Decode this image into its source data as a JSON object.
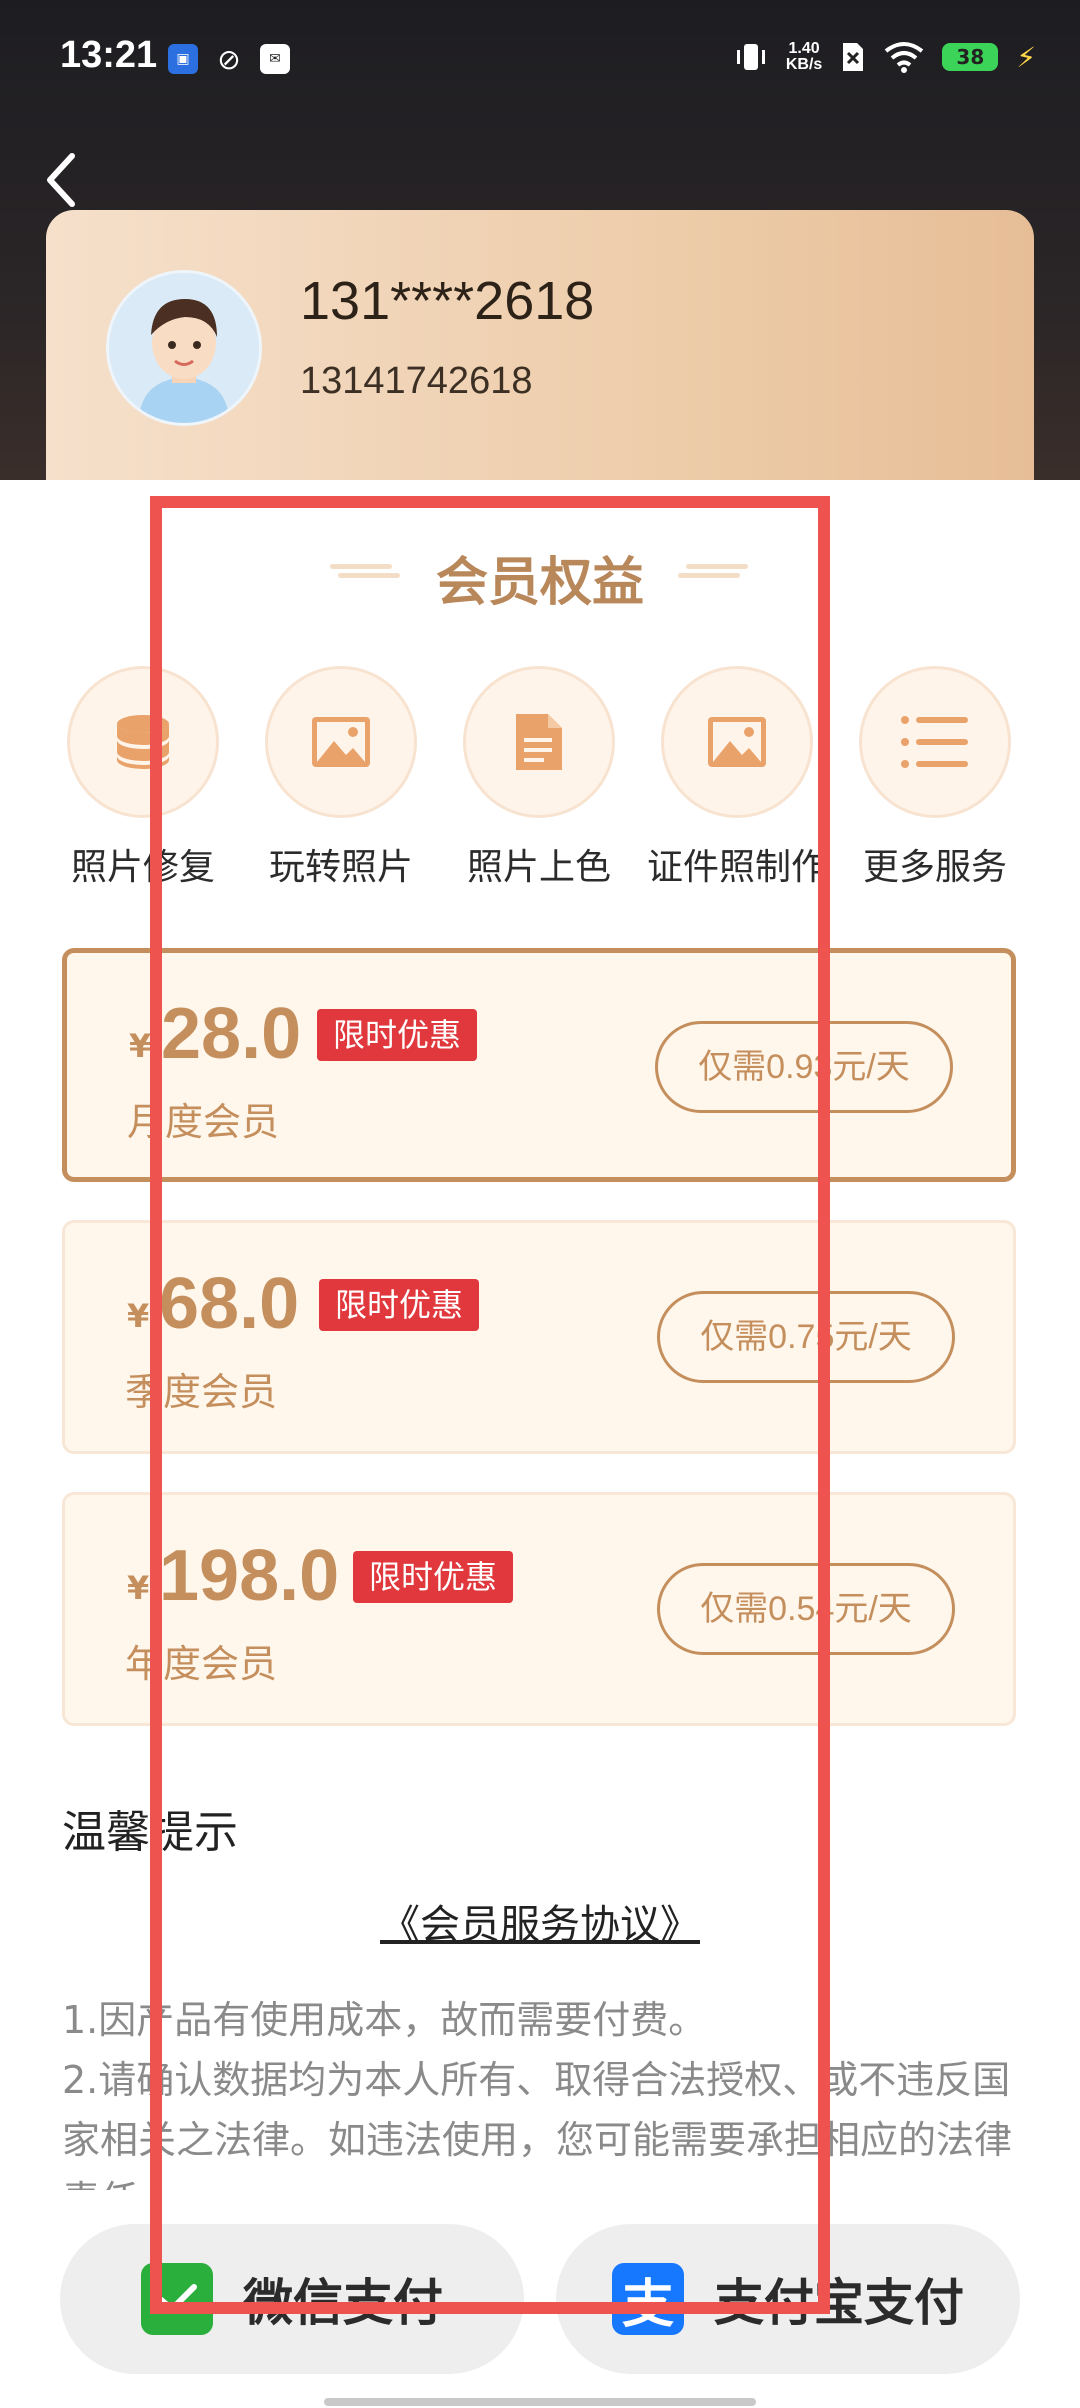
{
  "status_bar": {
    "time": "13:21",
    "speed_value": "1.40",
    "speed_unit": "KB/s",
    "battery": "38"
  },
  "profile": {
    "masked_name": "131****2618",
    "phone": "13141742618"
  },
  "benefits": {
    "title": "会员权益",
    "items": [
      {
        "label": "照片修复",
        "icon": "database-icon"
      },
      {
        "label": "玩转照片",
        "icon": "image-icon"
      },
      {
        "label": "照片上色",
        "icon": "document-icon"
      },
      {
        "label": "证件照制作",
        "icon": "image-icon"
      },
      {
        "label": "更多服务",
        "icon": "list-icon"
      }
    ]
  },
  "plans": [
    {
      "currency": "¥",
      "price": "28.0",
      "tag": "限时优惠",
      "name": "月度会员",
      "daily": "仅需0.93元/天",
      "selected": true
    },
    {
      "currency": "¥",
      "price": "68.0",
      "tag": "限时优惠",
      "name": "季度会员",
      "daily": "仅需0.75元/天",
      "selected": false
    },
    {
      "currency": "¥",
      "price": "198.0",
      "tag": "限时优惠",
      "name": "年度会员",
      "daily": "仅需0.54元/天",
      "selected": false
    }
  ],
  "tips": {
    "title": "温馨提示",
    "agreement": "《会员服务协议》",
    "line1": "1.因产品有使用成本，故而需要付费。",
    "line2": " 2.请确认数据均为本人所有、取得合法授权、或不违反国家相关之法律。如违法使用，您可能需要承担相应的法律责任。"
  },
  "payment": {
    "wechat_label": "微信支付",
    "alipay_label": "支付宝支付",
    "wechat_color": "#2aae3c",
    "alipay_color": "#1677ff"
  },
  "colors": {
    "accent": "#c48f5d",
    "tag_red": "#e0383c",
    "annotation_red": "#ef5350"
  }
}
